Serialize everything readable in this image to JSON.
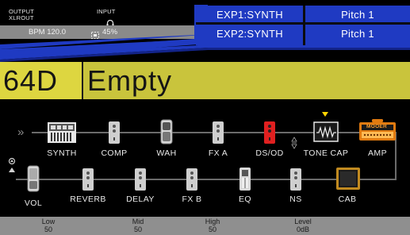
{
  "status": {
    "output_label": "OUTPUT",
    "output_value": "XLROUT",
    "input_label": "INPUT",
    "input_icon": "headphone-icon",
    "bpm": "BPM 120.0",
    "level": "45%"
  },
  "exp": [
    {
      "name": "EXP1:SYNTH",
      "param": "Pitch 1"
    },
    {
      "name": "EXP2:SYNTH",
      "param": "Pitch 1"
    }
  ],
  "colors": {
    "accent_blue": "#1f3ac2",
    "preset_yellow": "#ddd640",
    "preset_bar": "#c9c43c",
    "active_red": "#e02020",
    "amp_orange": "#e07a10",
    "cab_brown": "#c18a20",
    "selection_yellow": "#ffd400"
  },
  "preset": {
    "number": "64D",
    "name": "Empty"
  },
  "chain": {
    "row1": [
      {
        "label": "SYNTH",
        "icon": "synth-icon"
      },
      {
        "label": "COMP",
        "icon": "pedal-icon"
      },
      {
        "label": "WAH",
        "icon": "wah-pedal-icon"
      },
      {
        "label": "FX A",
        "icon": "pedal-icon"
      },
      {
        "label": "DS/OD",
        "icon": "pedal-icon"
      },
      {
        "label": "TONE CAP",
        "icon": "tone-cap-icon"
      },
      {
        "label": "AMP",
        "icon": "amp-icon"
      }
    ],
    "row2": [
      {
        "label": "VOL",
        "icon": "volume-pedal-icon"
      },
      {
        "label": "REVERB",
        "icon": "pedal-icon"
      },
      {
        "label": "DELAY",
        "icon": "pedal-icon"
      },
      {
        "label": "FX B",
        "icon": "pedal-icon"
      },
      {
        "label": "EQ",
        "icon": "eq-icon"
      },
      {
        "label": "NS",
        "icon": "pedal-icon"
      },
      {
        "label": "CAB",
        "icon": "cab-icon"
      }
    ],
    "amp_brand": "MOOER"
  },
  "params": [
    {
      "name": "Low",
      "value": "50"
    },
    {
      "name": "Mid",
      "value": "50"
    },
    {
      "name": "High",
      "value": "50"
    },
    {
      "name": "Level",
      "value": "0dB"
    }
  ]
}
